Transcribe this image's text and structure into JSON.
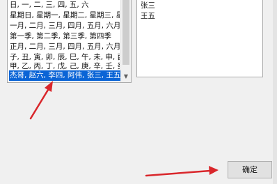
{
  "custom_lists": {
    "items": [
      "日, 一, 二, 三, 四, 五, 六",
      "星期日, 星期一, 星期二, 星期三, 星",
      "一月, 二月, 三月, 四月, 五月, 六月",
      "第一季, 第二季, 第三季, 第四季",
      "正月, 二月, 三月, 四月, 五月, 六月",
      "子, 丑, 寅, 卯, 辰, 巳, 午, 未, 申, 酉",
      "甲, 乙, 丙, 丁, 戊, 己, 庚, 辛, 壬, 癸",
      "杰哥, 赵六, 李四, 阿伟, 张三, 王五"
    ],
    "selected_index": 7
  },
  "list_entries": {
    "lines": [
      "张三",
      "王五"
    ]
  },
  "buttons": {
    "ok_label": "确定"
  },
  "annotation": {
    "arrow_color": "#d9262b"
  }
}
